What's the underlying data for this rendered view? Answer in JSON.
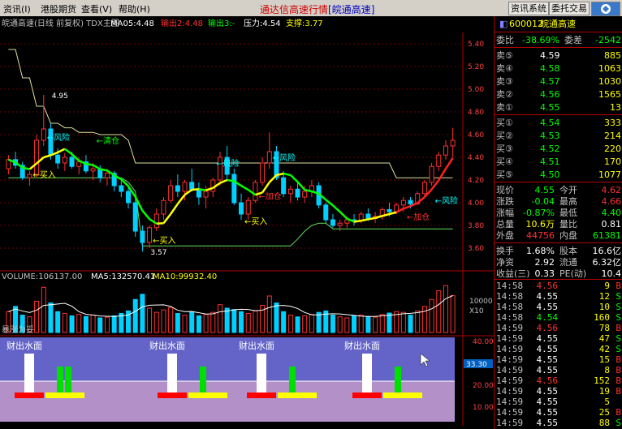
{
  "menu": [
    "资讯(I)",
    "港股期货",
    "查看(V)",
    "帮助(H)"
  ],
  "app_title": "通达信高速行情",
  "app_subtitle": "[皖通高速]",
  "toolbar": {
    "btn_info": "资讯系统",
    "btn_trade": "委托交易"
  },
  "chart": {
    "header": {
      "name": "皖通高速(日线 前复权) TDX主图",
      "ma": "MA05:4.48",
      "out1": "输出2:4.48",
      "out2": "输出3:-",
      "pressure": "压力:4.54",
      "support": "支撑:3.77"
    },
    "price_axis": [
      "5.40",
      "5.20",
      "5.00",
      "4.80",
      "4.60",
      "4.40",
      "4.20",
      "4.00",
      "3.80",
      "3.60"
    ],
    "annotations": {
      "high": "4.95",
      "low": "3.57",
      "risk": "风险",
      "clear": "清仓",
      "buy": "买入",
      "add": "加仓"
    },
    "volume_header": {
      "volume": "VOLUME:106137.00",
      "ma5": "MA5:132570.41",
      "ma10": "MA10:99932.40"
    },
    "vol_axis": "10000",
    "vol_unit": "X10",
    "indicator_header": "暴涨为妥",
    "indicator_label": "财出水面",
    "indicator_axis": [
      "40.00",
      "30.00",
      "20.00",
      "10.00"
    ],
    "indicator_current": "33.30",
    "chart_data": {
      "type": "candlestick",
      "price_range": [
        3.5,
        5.5
      ],
      "grid": true,
      "candles": [
        [
          4.3,
          4.42,
          4.25,
          4.38
        ],
        [
          4.38,
          4.45,
          4.3,
          4.33
        ],
        [
          4.33,
          4.36,
          4.2,
          4.22
        ],
        [
          4.22,
          4.28,
          4.15,
          4.25
        ],
        [
          4.25,
          4.6,
          4.22,
          4.55
        ],
        [
          4.55,
          4.95,
          4.5,
          4.65
        ],
        [
          4.65,
          4.7,
          4.38,
          4.42
        ],
        [
          4.42,
          4.48,
          4.3,
          4.35
        ],
        [
          4.35,
          4.44,
          4.28,
          4.4
        ],
        [
          4.4,
          4.45,
          4.3,
          4.32
        ],
        [
          4.32,
          4.4,
          4.25,
          4.36
        ],
        [
          4.36,
          4.42,
          4.26,
          4.28
        ],
        [
          4.28,
          4.35,
          4.2,
          4.3
        ],
        [
          4.3,
          4.33,
          4.18,
          4.22
        ],
        [
          4.22,
          4.3,
          4.15,
          4.26
        ],
        [
          4.26,
          4.28,
          4.1,
          4.15
        ],
        [
          4.15,
          4.2,
          4.05,
          4.1
        ],
        [
          4.1,
          4.15,
          3.95,
          4.0
        ],
        [
          4.0,
          4.05,
          3.7,
          3.75
        ],
        [
          3.75,
          3.8,
          3.57,
          3.65
        ],
        [
          3.65,
          3.8,
          3.6,
          3.78
        ],
        [
          3.78,
          3.95,
          3.75,
          3.9
        ],
        [
          3.9,
          4.05,
          3.85,
          4.02
        ],
        [
          4.02,
          4.2,
          4.0,
          4.15
        ],
        [
          4.15,
          4.25,
          4.05,
          4.1
        ],
        [
          4.1,
          4.2,
          4.02,
          4.18
        ],
        [
          4.18,
          4.3,
          4.1,
          4.12
        ],
        [
          4.12,
          4.18,
          3.98,
          4.05
        ],
        [
          4.05,
          4.15,
          3.95,
          4.1
        ],
        [
          4.1,
          4.22,
          4.05,
          4.2
        ],
        [
          4.2,
          4.45,
          4.15,
          4.4
        ],
        [
          4.4,
          4.5,
          4.2,
          4.25
        ],
        [
          4.25,
          4.3,
          3.98,
          4.0
        ],
        [
          4.0,
          4.08,
          3.85,
          3.9
        ],
        [
          3.9,
          4.05,
          3.85,
          4.02
        ],
        [
          4.02,
          4.2,
          4.0,
          4.18
        ],
        [
          4.18,
          4.4,
          4.15,
          4.35
        ],
        [
          4.35,
          4.62,
          4.3,
          4.45
        ],
        [
          4.45,
          4.5,
          4.2,
          4.22
        ],
        [
          4.22,
          4.28,
          4.05,
          4.08
        ],
        [
          4.08,
          4.15,
          4.0,
          4.12
        ],
        [
          4.12,
          4.18,
          4.02,
          4.05
        ],
        [
          4.05,
          4.15,
          4.0,
          4.1
        ],
        [
          4.1,
          4.2,
          4.05,
          4.15
        ],
        [
          4.15,
          4.18,
          3.95,
          3.98
        ],
        [
          3.98,
          4.0,
          3.82,
          3.85
        ],
        [
          3.85,
          3.9,
          3.78,
          3.8
        ],
        [
          3.8,
          3.85,
          3.75,
          3.82
        ],
        [
          3.82,
          3.88,
          3.78,
          3.85
        ],
        [
          3.85,
          3.9,
          3.8,
          3.84
        ],
        [
          3.84,
          3.92,
          3.82,
          3.9
        ],
        [
          3.9,
          3.95,
          3.84,
          3.86
        ],
        [
          3.86,
          3.92,
          3.82,
          3.88
        ],
        [
          3.88,
          3.96,
          3.85,
          3.94
        ],
        [
          3.94,
          4.0,
          3.88,
          3.92
        ],
        [
          3.92,
          4.0,
          3.9,
          3.98
        ],
        [
          3.98,
          4.05,
          3.92,
          4.02
        ],
        [
          4.02,
          4.05,
          3.95,
          3.99
        ],
        [
          3.99,
          4.1,
          3.98,
          4.08
        ],
        [
          4.08,
          4.2,
          4.05,
          4.18
        ],
        [
          4.18,
          4.35,
          4.15,
          4.32
        ],
        [
          4.32,
          4.45,
          4.28,
          4.42
        ],
        [
          4.42,
          4.55,
          4.38,
          4.5
        ],
        [
          4.5,
          4.66,
          4.4,
          4.55
        ]
      ],
      "volumes": [
        60,
        75,
        50,
        45,
        90,
        130,
        85,
        60,
        55,
        48,
        52,
        46,
        50,
        42,
        44,
        48,
        55,
        62,
        95,
        110,
        70,
        58,
        65,
        72,
        55,
        50,
        60,
        48,
        52,
        58,
        80,
        70,
        66,
        60,
        55,
        62,
        78,
        105,
        85,
        60,
        50,
        45,
        48,
        52,
        58,
        62,
        50,
        45,
        42,
        48,
        50,
        46,
        44,
        52,
        56,
        60,
        58,
        50,
        62,
        75,
        95,
        120,
        135,
        106
      ]
    }
  },
  "quote": {
    "code": "600012",
    "name": "皖通高速",
    "ratio_label": "委比",
    "ratio_pct": "-38.69%",
    "diff_label": "委差",
    "diff_val": "-2542",
    "sells": [
      [
        "卖⑤",
        "4.59",
        "885"
      ],
      [
        "卖④",
        "4.58",
        "1063"
      ],
      [
        "卖③",
        "4.57",
        "1030"
      ],
      [
        "卖②",
        "4.56",
        "1565"
      ],
      [
        "卖①",
        "4.55",
        "13"
      ]
    ],
    "buys": [
      [
        "买①",
        "4.54",
        "333"
      ],
      [
        "买②",
        "4.53",
        "214"
      ],
      [
        "买③",
        "4.52",
        "220"
      ],
      [
        "买④",
        "4.51",
        "170"
      ],
      [
        "买⑤",
        "4.50",
        "1077"
      ]
    ],
    "stats": [
      [
        "现价",
        "4.55",
        "今开",
        "4.62"
      ],
      [
        "涨跌",
        "-0.04",
        "最高",
        "4.66"
      ],
      [
        "涨幅",
        "-0.87%",
        "最低",
        "4.40"
      ],
      [
        "总量",
        "10.6万",
        "量比",
        "0.81"
      ],
      [
        "外盘",
        "44756",
        "内盘",
        "61381"
      ]
    ],
    "stats2": [
      [
        "换手",
        "1.68%",
        "股本",
        "16.6亿"
      ],
      [
        "净资",
        "2.92",
        "流通",
        "6.32亿"
      ],
      [
        "收益(三)",
        "0.33",
        "PE(动)",
        "10.4"
      ]
    ],
    "ticks": [
      [
        "14:58",
        "4.56",
        "9",
        "B"
      ],
      [
        "14:58",
        "4.55",
        "12",
        "S"
      ],
      [
        "14:58",
        "4.55",
        "10",
        "S"
      ],
      [
        "14:58",
        "4.54",
        "160",
        "S"
      ],
      [
        "14:59",
        "4.56",
        "78",
        "B"
      ],
      [
        "14:59",
        "4.55",
        "47",
        "S"
      ],
      [
        "14:59",
        "4.55",
        "42",
        "S"
      ],
      [
        "14:59",
        "4.55",
        "15",
        "B"
      ],
      [
        "14:59",
        "4.55",
        "8",
        "B"
      ],
      [
        "14:59",
        "4.56",
        "152",
        "B"
      ],
      [
        "14:59",
        "4.55",
        "19",
        "B"
      ],
      [
        "14:59",
        "4.55",
        "5",
        ""
      ],
      [
        "14:59",
        "4.55",
        "25",
        "B"
      ],
      [
        "14:59",
        "4.55",
        "88",
        "S"
      ]
    ]
  }
}
